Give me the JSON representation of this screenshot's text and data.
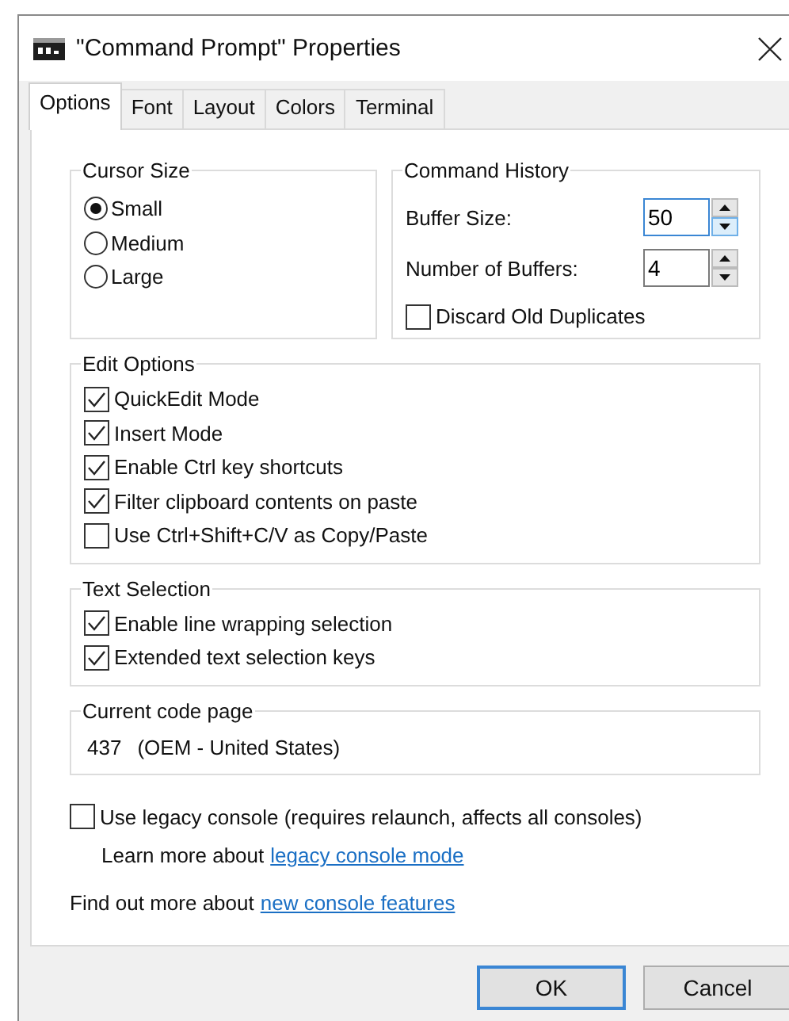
{
  "window": {
    "title": "\"Command Prompt\" Properties"
  },
  "tabs": [
    {
      "label": "Options",
      "selected": true
    },
    {
      "label": "Font",
      "selected": false
    },
    {
      "label": "Layout",
      "selected": false
    },
    {
      "label": "Colors",
      "selected": false
    },
    {
      "label": "Terminal",
      "selected": false
    }
  ],
  "cursor_size": {
    "title": "Cursor Size",
    "options": [
      {
        "label": "Small",
        "selected": true
      },
      {
        "label": "Medium",
        "selected": false
      },
      {
        "label": "Large",
        "selected": false
      }
    ]
  },
  "command_history": {
    "title": "Command History",
    "fields": [
      {
        "label": "Buffer Size:",
        "value": "50",
        "focused": true
      },
      {
        "label": "Number of Buffers:",
        "value": "4",
        "focused": false
      }
    ],
    "discard": {
      "label": "Discard Old Duplicates",
      "checked": false
    }
  },
  "edit_options": {
    "title": "Edit Options",
    "items": [
      {
        "label": "QuickEdit Mode",
        "checked": true
      },
      {
        "label": "Insert Mode",
        "checked": true
      },
      {
        "label": "Enable Ctrl key shortcuts",
        "checked": true
      },
      {
        "label": "Filter clipboard contents on paste",
        "checked": true
      },
      {
        "label": "Use Ctrl+Shift+C/V as Copy/Paste",
        "checked": false
      }
    ]
  },
  "text_selection": {
    "title": "Text Selection",
    "items": [
      {
        "label": "Enable line wrapping selection",
        "checked": true
      },
      {
        "label": "Extended text selection keys",
        "checked": true
      }
    ]
  },
  "code_page": {
    "title": "Current code page",
    "number": "437",
    "name": "(OEM - United States)"
  },
  "legacy": {
    "label": "Use legacy console (requires relaunch, affects all consoles)",
    "checked": false,
    "note": "Learn more about",
    "link": "legacy console mode"
  },
  "footer": {
    "text": "Find out more about",
    "link": "new console features"
  },
  "buttons": [
    {
      "label": "OK",
      "default": true
    },
    {
      "label": "Cancel",
      "default": false
    }
  ]
}
